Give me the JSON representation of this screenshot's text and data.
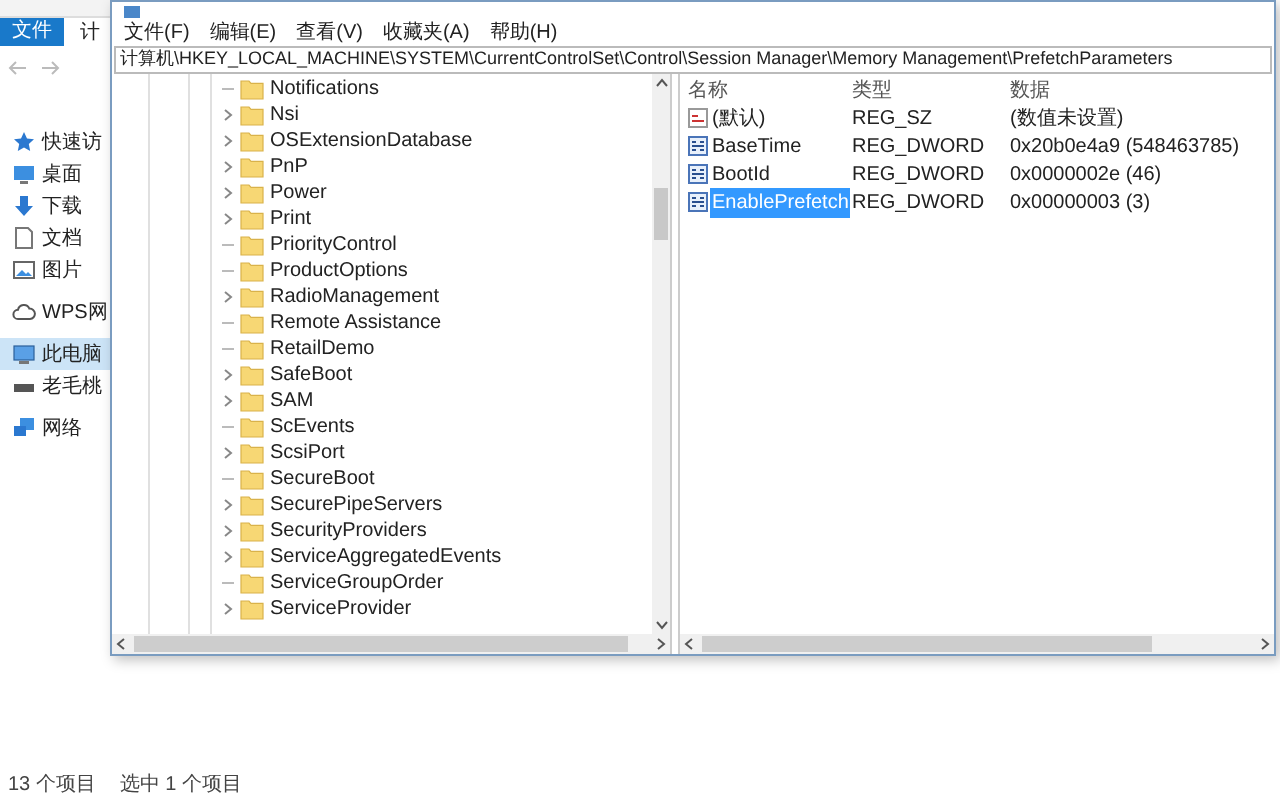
{
  "explorer": {
    "ribbon_tab": "文件",
    "address_partial": "计",
    "nav_items": [
      {
        "label": "快速访",
        "kind": "star",
        "selected": false
      },
      {
        "label": "桌面",
        "kind": "desktop",
        "selected": false
      },
      {
        "label": "下载",
        "kind": "download",
        "selected": false
      },
      {
        "label": "文档",
        "kind": "document",
        "selected": false
      },
      {
        "label": "图片",
        "kind": "picture",
        "selected": false
      },
      {
        "label": "WPS网",
        "kind": "cloud",
        "selected": false
      },
      {
        "label": "此电脑",
        "kind": "computer",
        "selected": true
      },
      {
        "label": "老毛桃",
        "kind": "drive",
        "selected": false
      },
      {
        "label": "网络",
        "kind": "network",
        "selected": false
      }
    ],
    "status_bar": [
      "13 个项目",
      "选中 1 个项目"
    ]
  },
  "registry": {
    "menu": [
      "文件(F)",
      "编辑(E)",
      "查看(V)",
      "收藏夹(A)",
      "帮助(H)"
    ],
    "address": "计算机\\HKEY_LOCAL_MACHINE\\SYSTEM\\CurrentControlSet\\Control\\Session Manager\\Memory Management\\PrefetchParameters",
    "tree_items": [
      {
        "label": "Notifications",
        "expandable": false
      },
      {
        "label": "Nsi",
        "expandable": true
      },
      {
        "label": "OSExtensionDatabase",
        "expandable": true
      },
      {
        "label": "PnP",
        "expandable": true
      },
      {
        "label": "Power",
        "expandable": true
      },
      {
        "label": "Print",
        "expandable": true
      },
      {
        "label": "PriorityControl",
        "expandable": false
      },
      {
        "label": "ProductOptions",
        "expandable": false
      },
      {
        "label": "RadioManagement",
        "expandable": true
      },
      {
        "label": "Remote Assistance",
        "expandable": false
      },
      {
        "label": "RetailDemo",
        "expandable": false
      },
      {
        "label": "SafeBoot",
        "expandable": true
      },
      {
        "label": "SAM",
        "expandable": true
      },
      {
        "label": "ScEvents",
        "expandable": false
      },
      {
        "label": "ScsiPort",
        "expandable": true
      },
      {
        "label": "SecureBoot",
        "expandable": false
      },
      {
        "label": "SecurePipeServers",
        "expandable": true
      },
      {
        "label": "SecurityProviders",
        "expandable": true
      },
      {
        "label": "ServiceAggregatedEvents",
        "expandable": true
      },
      {
        "label": "ServiceGroupOrder",
        "expandable": false
      },
      {
        "label": "ServiceProvider",
        "expandable": true
      }
    ],
    "columns": [
      "名称",
      "类型",
      "数据"
    ],
    "values": [
      {
        "name": "(默认)",
        "type": "REG_SZ",
        "data": "(数值未设置)",
        "kind": "string",
        "selected": false
      },
      {
        "name": "BaseTime",
        "type": "REG_DWORD",
        "data": "0x20b0e4a9 (548463785)",
        "kind": "binary",
        "selected": false
      },
      {
        "name": "BootId",
        "type": "REG_DWORD",
        "data": "0x0000002e (46)",
        "kind": "binary",
        "selected": false
      },
      {
        "name": "EnablePrefetch",
        "type": "REG_DWORD",
        "data": "0x00000003 (3)",
        "kind": "binary",
        "selected": true
      }
    ]
  }
}
